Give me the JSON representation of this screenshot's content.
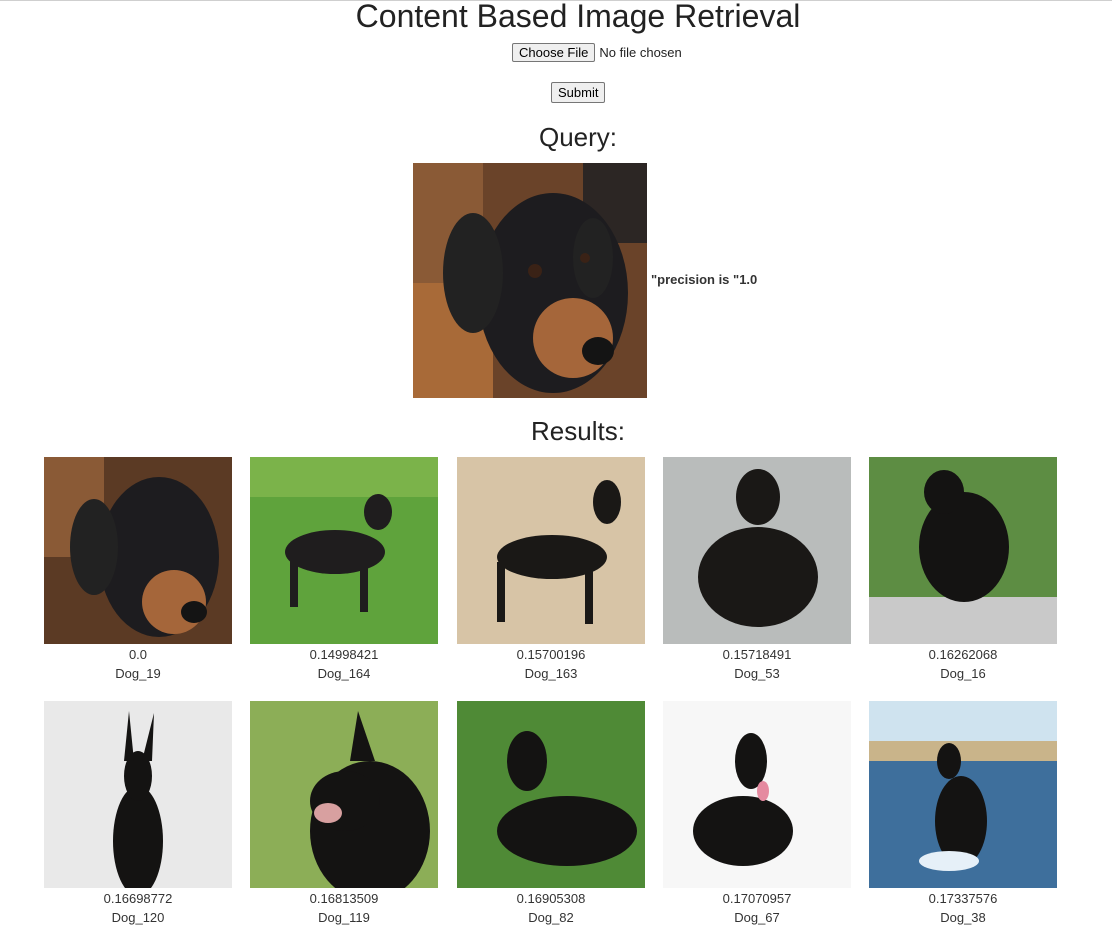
{
  "page": {
    "title": "Content Based Image Retrieval"
  },
  "upload": {
    "choose_label": "Choose File",
    "status": "No file chosen",
    "submit_label": "Submit"
  },
  "query": {
    "heading": "Query:",
    "precision_text": "\"precision is \"1.0"
  },
  "results": {
    "heading": "Results:",
    "items": [
      {
        "score": "0.0",
        "label": "Dog_19",
        "bg": "#5b3a24"
      },
      {
        "score": "0.14998421",
        "label": "Dog_164",
        "bg": "#5fa33c"
      },
      {
        "score": "0.15700196",
        "label": "Dog_163",
        "bg": "#d7c4a6"
      },
      {
        "score": "0.15718491",
        "label": "Dog_53",
        "bg": "#b9bcbb"
      },
      {
        "score": "0.16262068",
        "label": "Dog_16",
        "bg": "#5d8d43"
      },
      {
        "score": "0.16698772",
        "label": "Dog_120",
        "bg": "#e9e9e9"
      },
      {
        "score": "0.16813509",
        "label": "Dog_119",
        "bg": "#8cae57"
      },
      {
        "score": "0.16905308",
        "label": "Dog_82",
        "bg": "#4f8a36"
      },
      {
        "score": "0.17070957",
        "label": "Dog_67",
        "bg": "#f7f7f7"
      },
      {
        "score": "0.17337576",
        "label": "Dog_38",
        "bg": "#3e6f9c"
      }
    ]
  }
}
